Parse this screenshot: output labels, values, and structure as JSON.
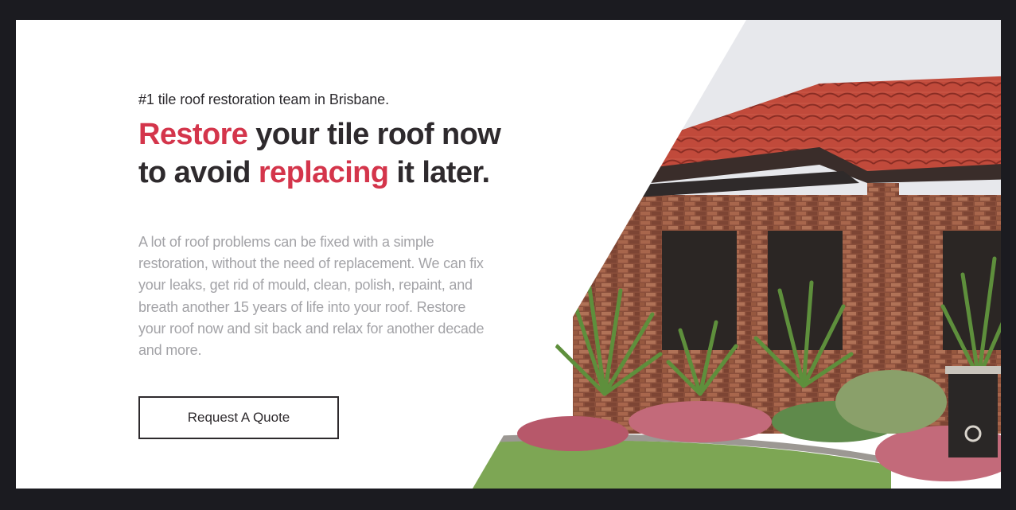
{
  "hero": {
    "tagline": "#1 tile roof restoration team in Brisbane.",
    "headline": {
      "line1_accent": "Restore",
      "line1_rest": " your tile roof now",
      "line2_start": "to avoid ",
      "line2_accent": "replacing",
      "line2_end": " it later."
    },
    "description": "A lot of roof problems can be fixed with a simple restoration, without the need of replacement. We can fix your leaks, get rid of mould, clean, polish, repaint, and breath another 15 years of life into your roof. Restore your roof now and sit back and relax for another decade and more.",
    "cta_label": "Request A Quote",
    "image_subject": "house-with-red-tile-roof"
  },
  "colors": {
    "accent": "#d4354b",
    "heading": "#2e2a2d",
    "body_text": "#a3a3a7",
    "page_border": "#1b1b20"
  }
}
